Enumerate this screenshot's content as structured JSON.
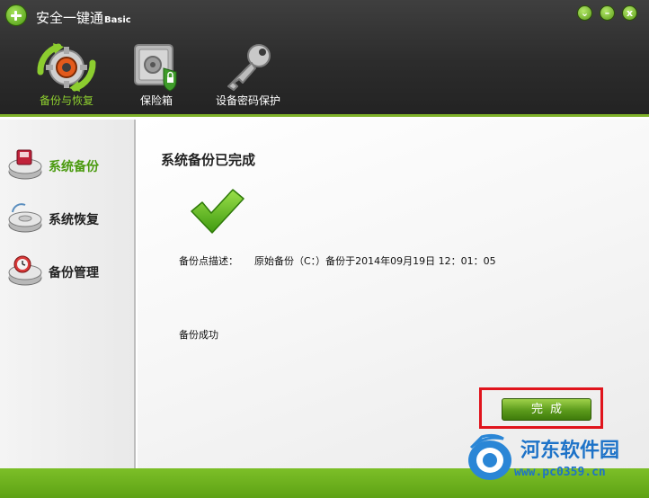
{
  "window": {
    "title": "安全一键通",
    "title_suffix": "Basic",
    "controls": [
      "⌄",
      "–",
      "x"
    ]
  },
  "toolbar": {
    "items": [
      {
        "label": "备份与恢复",
        "icon": "gear-refresh-icon",
        "active": true
      },
      {
        "label": "保险箱",
        "icon": "safe-icon",
        "active": false
      },
      {
        "label": "设备密码保护",
        "icon": "key-icon",
        "active": false
      }
    ]
  },
  "sidebar": {
    "items": [
      {
        "label": "系统备份",
        "icon": "disk-backup-icon",
        "active": true
      },
      {
        "label": "系统恢复",
        "icon": "disk-restore-icon",
        "active": false
      },
      {
        "label": "备份管理",
        "icon": "disk-manage-icon",
        "active": false
      }
    ]
  },
  "content": {
    "title": "系统备份已完成",
    "desc_label": "备份点描述：",
    "desc_value": "原始备份（C：）备份于2014年09月19日 12：01：05",
    "result": "备份成功",
    "done_button": "完成"
  },
  "colors": {
    "accent": "#7fb22a",
    "topbar": "#2c2c2c",
    "highlight_frame": "#e0141c",
    "watermark": "#1e73c8"
  },
  "watermark": {
    "title": "河东软件园",
    "url": "www.pc0359.cn"
  }
}
